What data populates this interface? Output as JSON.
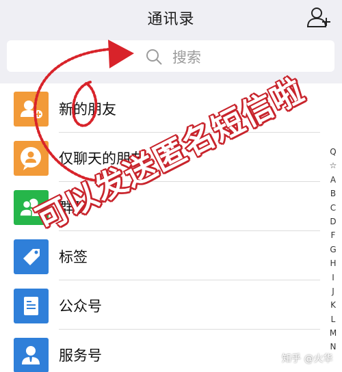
{
  "header": {
    "title": "通讯录",
    "add_contact_icon": "add-contact-icon"
  },
  "search": {
    "placeholder": "搜索",
    "icon": "search-icon"
  },
  "contacts": [
    {
      "label": "新的朋友",
      "icon": "new-friend-icon",
      "color": "#f29a38"
    },
    {
      "label": "仅聊天的朋友",
      "icon": "chat-only-friend-icon",
      "color": "#f29a38"
    },
    {
      "label": "群聊",
      "icon": "group-chat-icon",
      "color": "#26b64a"
    },
    {
      "label": "标签",
      "icon": "tag-icon",
      "color": "#2f7fd9"
    },
    {
      "label": "公众号",
      "icon": "official-account-icon",
      "color": "#2f7fd9"
    },
    {
      "label": "服务号",
      "icon": "service-account-icon",
      "color": "#2f7fd9"
    }
  ],
  "index_bar": [
    "Q",
    "☆",
    "A",
    "B",
    "C",
    "D",
    "F",
    "G",
    "H",
    "I",
    "J",
    "K",
    "L",
    "M",
    "N"
  ],
  "overlay": {
    "text": "可以发送匿名短信啦",
    "color": "#c8242c"
  },
  "watermark": "知乎 @火华"
}
